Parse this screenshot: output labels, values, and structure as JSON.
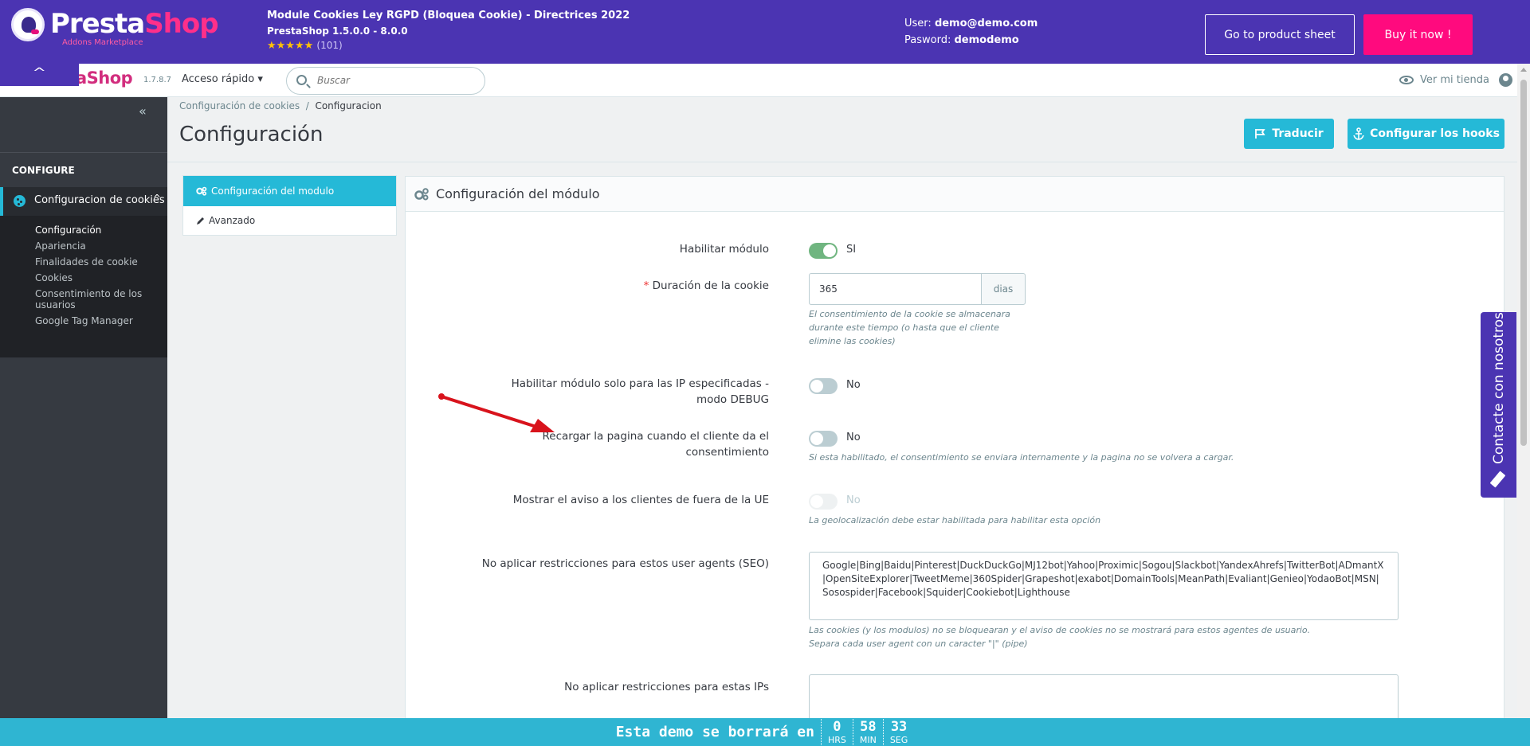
{
  "banner": {
    "logo_main": "Presta",
    "logo_accent": "Shop",
    "logo_sub": "Addons Marketplace",
    "module_title": "Module Cookies Ley RGPD (Bloquea Cookie) - Directrices 2022",
    "module_version": "PrestaShop 1.5.0.0 - 8.0.0",
    "stars": "★★★★★",
    "rating_count": "(101)",
    "user_label": "User:",
    "user_value": "demo@demo.com",
    "password_label": "Pasword:",
    "password_value": "demodemo",
    "product_sheet_button": "Go to product sheet",
    "buy_button": "Buy it now !",
    "collapse_icon": "chevron-up-icon"
  },
  "admin_header": {
    "logo": "aShop",
    "version": "1.7.8.7",
    "quick_access": "Acceso rápido ▾",
    "search_placeholder": "Buscar",
    "view_store": "Ver mi tienda"
  },
  "sidebar": {
    "toggle": "«",
    "heading": "CONFIGURE",
    "active_item": "Configuracion de cookies",
    "chevron": "^",
    "sub_items": [
      "Configuración",
      "Apariencia",
      "Finalidades de cookie",
      "Cookies",
      "Consentimiento de los usuarios",
      "Google Tag Manager"
    ]
  },
  "page": {
    "breadcrumb_parent": "Configuración de cookies",
    "breadcrumb_sep": "/",
    "breadcrumb_current": "Configuracion",
    "title": "Configuración",
    "translate_button": "Traducir",
    "hooks_button": "Configurar los hooks"
  },
  "tabs": [
    {
      "label": "Configuración del modulo"
    },
    {
      "label": "Avanzado"
    }
  ],
  "panel": {
    "title": "Configuración del módulo",
    "enable_module": {
      "label": "Habilitar módulo",
      "value": "SI",
      "on": true
    },
    "cookie_duration": {
      "required_mark": "*",
      "label": "Duración de la cookie",
      "value": "365",
      "addon": "dias",
      "help": "El consentimiento de la cookie se almacenara durante este tiempo (o hasta que el cliente elimine las cookies)"
    },
    "debug_ip": {
      "label_line1": "Habilitar módulo solo para las IP especificadas -",
      "label_line2": "modo DEBUG",
      "value": "No",
      "on": false
    },
    "reload_page": {
      "label_line1": "Recargar la pagina cuando el cliente da el",
      "label_line2": "consentimiento",
      "value": "No",
      "on": false,
      "help": "Si esta habilitado, el consentimiento se enviara internamente y la pagina no se volvera a cargar."
    },
    "non_eu": {
      "label": "Mostrar el aviso a los clientes de fuera de la UE",
      "value": "No",
      "disabled": true,
      "help": "La geolocalización debe estar habilitada para habilitar esta opción"
    },
    "user_agents": {
      "label": "No aplicar restricciones para estos user agents (SEO)",
      "value": "Google|Bing|Baidu|Pinterest|DuckDuckGo|MJ12bot|Yahoo|Proximic|Sogou|Slackbot|YandexAhrefs|TwitterBot|ADmantX|OpenSiteExplorer|TweetMeme|360Spider|Grapeshot|exabot|DomainTools|MeanPath|Evaliant|Genieo|YodaoBot|MSN|Sosospider|Facebook|Squider|Cookiebot|Lighthouse",
      "help_line1": "Las cookies (y los modulos) no se bloquearan y el aviso de cookies no se mostrará para estos agentes de usuario.",
      "help_line2": "Separa cada user agent con un caracter \"|\" (pipe)"
    },
    "ips": {
      "label": "No aplicar restricciones para estas IPs",
      "value": ""
    }
  },
  "contact_tab": {
    "label": "Contacte con nosotros"
  },
  "demo_bar": {
    "text": "Esta demo se borrará en",
    "hours": "0",
    "hours_label": "HRS",
    "minutes": "58",
    "minutes_label": "MIN",
    "seconds": "33",
    "seconds_label": "SEG"
  },
  "colors": {
    "banner": "#4b34b2",
    "accent": "#25b9d7",
    "buy": "#ff0a7e",
    "switch_on": "#70b580"
  }
}
